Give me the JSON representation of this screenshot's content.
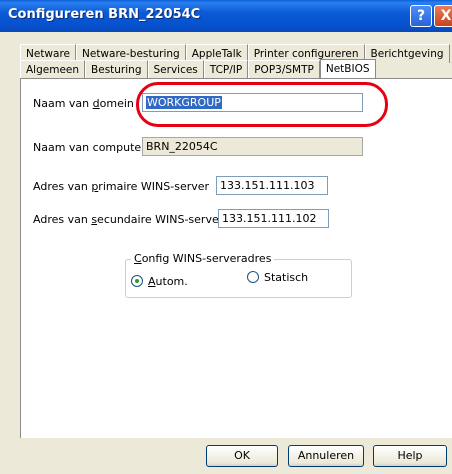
{
  "window": {
    "title": "Configureren BRN_22054C",
    "help_glyph": "?",
    "close_glyph": "X"
  },
  "tabs": {
    "row1": [
      "Netware",
      "Netware-besturing",
      "AppleTalk",
      "Printer configureren",
      "Berichtgeving"
    ],
    "row2": [
      "Algemeen",
      "Besturing",
      "Services",
      "TCP/IP",
      "POP3/SMTP",
      "NetBIOS"
    ],
    "active": "NetBIOS"
  },
  "form": {
    "domain_label_pre": "Naam van ",
    "domain_label_key": "d",
    "domain_label_post": "omein",
    "domain_value": "WORKGROUP",
    "computer_label": "Naam van computer",
    "computer_value": "BRN_22054C",
    "wins_primary_label_pre": "Adres van ",
    "wins_primary_label_key": "p",
    "wins_primary_label_post": "rimaire WINS-server",
    "wins_primary_value": "133.151.111.103",
    "wins_secondary_label_pre": "Adres van ",
    "wins_secondary_label_key": "s",
    "wins_secondary_label_post": "ecundaire WINS-server",
    "wins_secondary_value": "133.151.111.102"
  },
  "wins_group": {
    "title_key": "C",
    "title_rest": "onfig WINS-serveradres",
    "option_auto_key": "A",
    "option_auto_rest": "utom.",
    "option_static": "Statisch",
    "selected": "auto"
  },
  "buttons": {
    "ok": "OK",
    "cancel": "Annuleren",
    "help": "Help"
  },
  "colors": {
    "highlight": "#e60012",
    "titlebar": "#0b5ad6"
  }
}
